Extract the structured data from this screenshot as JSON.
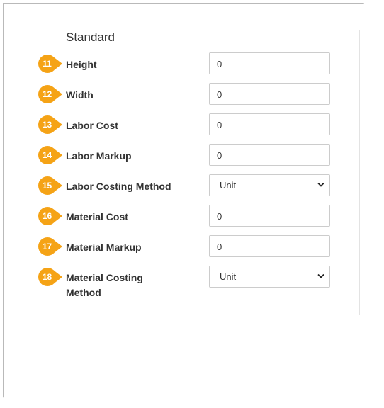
{
  "section": {
    "title": "Standard"
  },
  "fields": [
    {
      "badge": "11",
      "label": "Height",
      "type": "input",
      "value": "0"
    },
    {
      "badge": "12",
      "label": "Width",
      "type": "input",
      "value": "0"
    },
    {
      "badge": "13",
      "label": "Labor Cost",
      "type": "input",
      "value": "0"
    },
    {
      "badge": "14",
      "label": "Labor Markup",
      "type": "input",
      "value": "0"
    },
    {
      "badge": "15",
      "label": "Labor Costing Method",
      "type": "select",
      "value": "Unit"
    },
    {
      "badge": "16",
      "label": "Material Cost",
      "type": "input",
      "value": "0"
    },
    {
      "badge": "17",
      "label": "Material Markup",
      "type": "input",
      "value": "0"
    },
    {
      "badge": "18",
      "label": "Material Costing Method",
      "type": "select",
      "value": "Unit"
    }
  ],
  "colors": {
    "badge": "#f5a316",
    "badge_text": "#ffffff",
    "label": "#333333",
    "border": "#cccccc"
  },
  "icons": {
    "badge_shape": "callout-arrow-icon",
    "select_arrow": "chevron-down-icon"
  }
}
